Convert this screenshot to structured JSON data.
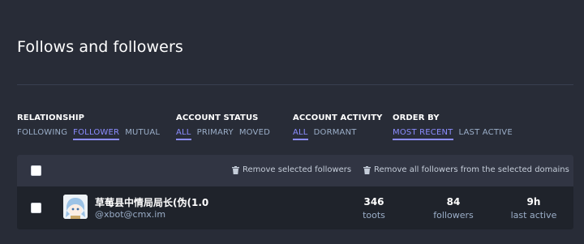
{
  "page": {
    "title": "Follows and followers"
  },
  "filters": [
    {
      "label": "RELATIONSHIP",
      "options": [
        "FOLLOWING",
        "FOLLOWER",
        "MUTUAL"
      ],
      "selected": "FOLLOWER"
    },
    {
      "label": "ACCOUNT STATUS",
      "options": [
        "ALL",
        "PRIMARY",
        "MOVED"
      ],
      "selected": "ALL"
    },
    {
      "label": "ACCOUNT ACTIVITY",
      "options": [
        "ALL",
        "DORMANT"
      ],
      "selected": "ALL"
    },
    {
      "label": "ORDER BY",
      "options": [
        "MOST RECENT",
        "LAST ACTIVE"
      ],
      "selected": "MOST RECENT"
    }
  ],
  "batch_actions": {
    "remove_selected": "Remove selected followers",
    "remove_domains": "Remove all followers from the selected domains"
  },
  "accounts": [
    {
      "display_name": "草莓县中情局局长(伪(1.0",
      "handle": "@xbot@cmx.im",
      "stats": [
        {
          "value": "346",
          "label": "toots"
        },
        {
          "value": "84",
          "label": "followers"
        },
        {
          "value": "9h",
          "label": "last active"
        }
      ]
    }
  ],
  "colors": {
    "background": "#282c37",
    "accent": "#8c8dff",
    "muted": "#9baec8"
  }
}
